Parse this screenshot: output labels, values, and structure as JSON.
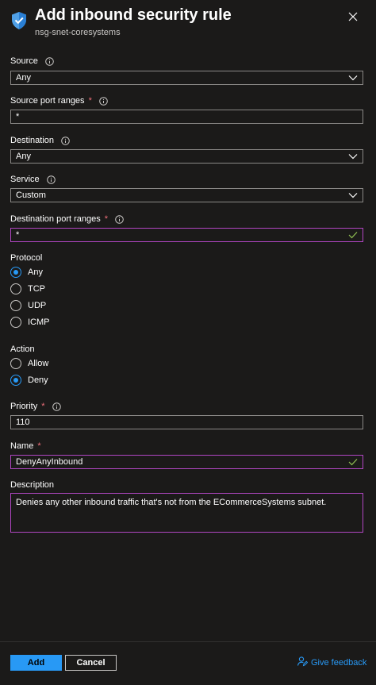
{
  "header": {
    "title": "Add inbound security rule",
    "subtitle": "nsg-snet-coresystems"
  },
  "fields": {
    "source": {
      "label": "Source",
      "value": "Any"
    },
    "source_port_ranges": {
      "label": "Source port ranges",
      "required_mark": "*",
      "value": "*"
    },
    "destination": {
      "label": "Destination",
      "value": "Any"
    },
    "service": {
      "label": "Service",
      "value": "Custom"
    },
    "destination_port_ranges": {
      "label": "Destination port ranges",
      "required_mark": "*",
      "value": "*"
    },
    "protocol": {
      "label": "Protocol",
      "options": [
        "Any",
        "TCP",
        "UDP",
        "ICMP"
      ],
      "selected": "Any"
    },
    "action": {
      "label": "Action",
      "options": [
        "Allow",
        "Deny"
      ],
      "selected": "Deny"
    },
    "priority": {
      "label": "Priority",
      "required_mark": "*",
      "value": "110"
    },
    "name": {
      "label": "Name",
      "required_mark": "*",
      "value": "DenyAnyInbound"
    },
    "description": {
      "label": "Description",
      "value": "Denies any other inbound traffic that's not from the ECommerceSystems subnet."
    }
  },
  "footer": {
    "add_label": "Add",
    "cancel_label": "Cancel",
    "feedback_label": "Give feedback"
  },
  "colors": {
    "background": "#1b1a19",
    "accent": "#2899f5",
    "valid_border": "#b146c2",
    "required": "#f1707b",
    "valid_check": "#92c353"
  },
  "icons": {
    "header": "shield-icon",
    "close": "close-icon",
    "info": "info-icon",
    "dropdown": "chevron-down-icon",
    "valid": "checkmark-icon",
    "feedback": "feedback-icon"
  }
}
